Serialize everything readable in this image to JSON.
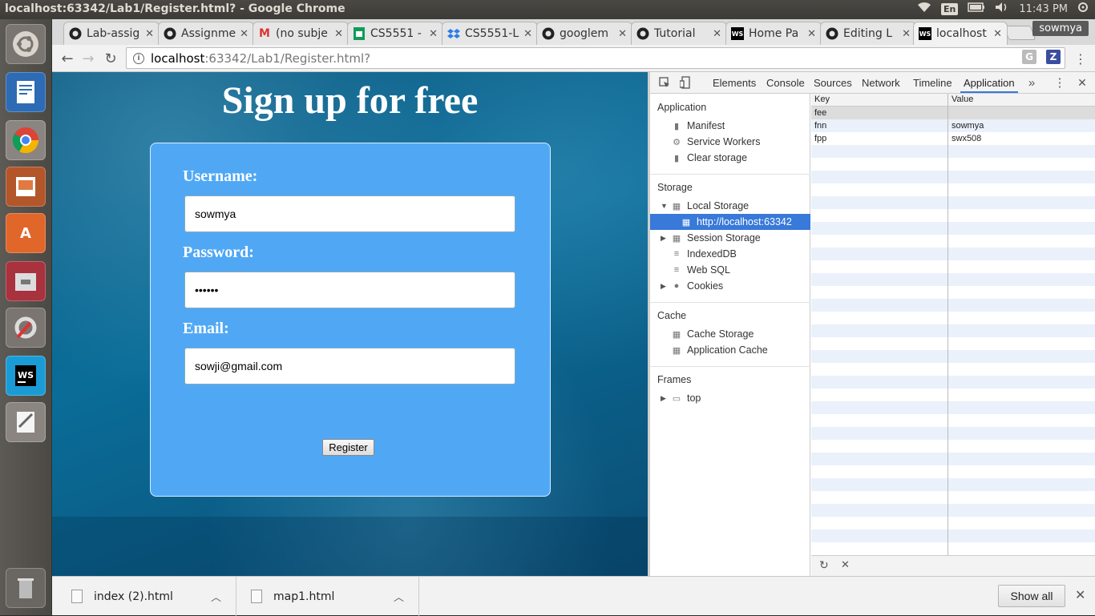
{
  "os": {
    "window_title": "localhost:63342/Lab1/Register.html? - Google Chrome",
    "keyboard_lang": "En",
    "clock": "11:43 PM"
  },
  "browser": {
    "profile": "sowmya",
    "tabs": [
      {
        "label": "Lab-assig",
        "icon": "github-icon"
      },
      {
        "label": "Assignme",
        "icon": "github-icon"
      },
      {
        "label": "(no subje",
        "icon": "gmail-icon"
      },
      {
        "label": "CS5551 -",
        "icon": "sheets-icon"
      },
      {
        "label": "CS5551-L",
        "icon": "dropbox-icon"
      },
      {
        "label": "googlem",
        "icon": "github-icon"
      },
      {
        "label": "Tutorial",
        "icon": "github-icon"
      },
      {
        "label": "Home Pa",
        "icon": "webstorm-icon"
      },
      {
        "label": "Editing L",
        "icon": "github-icon"
      },
      {
        "label": "localhost",
        "icon": "webstorm-icon"
      }
    ],
    "url_host": "localhost",
    "url_rest": ":63342/Lab1/Register.html?"
  },
  "page": {
    "heading": "Sign up for free",
    "username_label": "Username:",
    "username_value": "sowmya",
    "password_label": "Password:",
    "password_value": "••••••",
    "email_label": "Email:",
    "email_value": "sowji@gmail.com",
    "register_label": "Register"
  },
  "devtools": {
    "tabs": [
      "Elements",
      "Console",
      "Sources",
      "Network",
      "Timeline",
      "Application"
    ],
    "active_tab": "Application",
    "sidebar": {
      "application_header": "Application",
      "manifest": "Manifest",
      "service_workers": "Service Workers",
      "clear_storage": "Clear storage",
      "storage_header": "Storage",
      "local_storage": "Local Storage",
      "local_storage_origin": "http://localhost:63342",
      "session_storage": "Session Storage",
      "indexeddb": "IndexedDB",
      "websql": "Web SQL",
      "cookies": "Cookies",
      "cache_header": "Cache",
      "cache_storage": "Cache Storage",
      "app_cache": "Application Cache",
      "frames_header": "Frames",
      "top_frame": "top"
    },
    "table": {
      "key_header": "Key",
      "value_header": "Value",
      "rows": [
        {
          "key": "fee",
          "value": ""
        },
        {
          "key": "fnn",
          "value": "sowmya"
        },
        {
          "key": "fpp",
          "value": "swx508"
        }
      ]
    }
  },
  "downloads": {
    "items": [
      "index (2).html",
      "map1.html"
    ],
    "show_all": "Show all"
  }
}
